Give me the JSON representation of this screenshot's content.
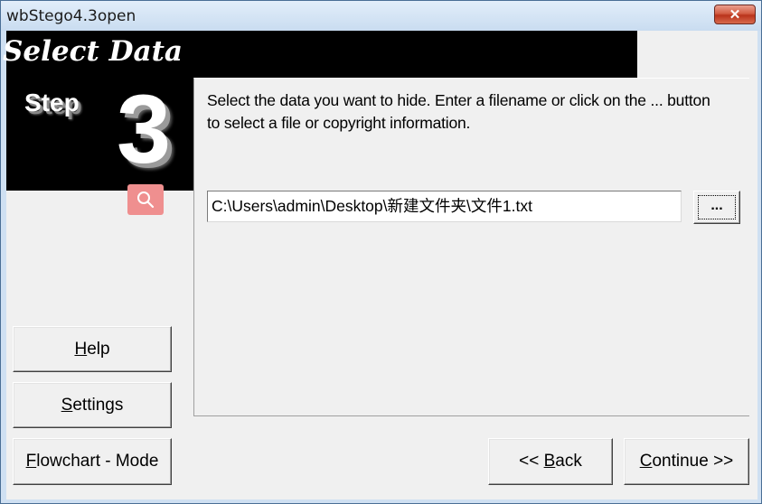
{
  "window": {
    "title": "wbStego4.3open",
    "close_glyph": "✕"
  },
  "header": {
    "title": "Select Data",
    "step_label": "Step",
    "step_number": "3"
  },
  "content": {
    "instructions": "Select the data you want to hide. Enter a filename or click on the ... button to select a file or copyright information.",
    "file_path": "C:\\Users\\admin\\Desktop\\新建文件夹\\文件1.txt",
    "browse_label": "..."
  },
  "buttons": {
    "help": {
      "mnemonic": "H",
      "rest": "elp"
    },
    "settings": {
      "mnemonic": "S",
      "rest": "ettings"
    },
    "flowchart": {
      "mnemonic": "F",
      "rest": "lowchart - Mode"
    },
    "back": {
      "prefix": "<< ",
      "mnemonic": "B",
      "rest": "ack"
    },
    "continue": {
      "mnemonic": "C",
      "rest": "ontinue >>"
    }
  },
  "icons": {
    "badge": "search-icon",
    "badge_color": "#ef8f8f"
  }
}
